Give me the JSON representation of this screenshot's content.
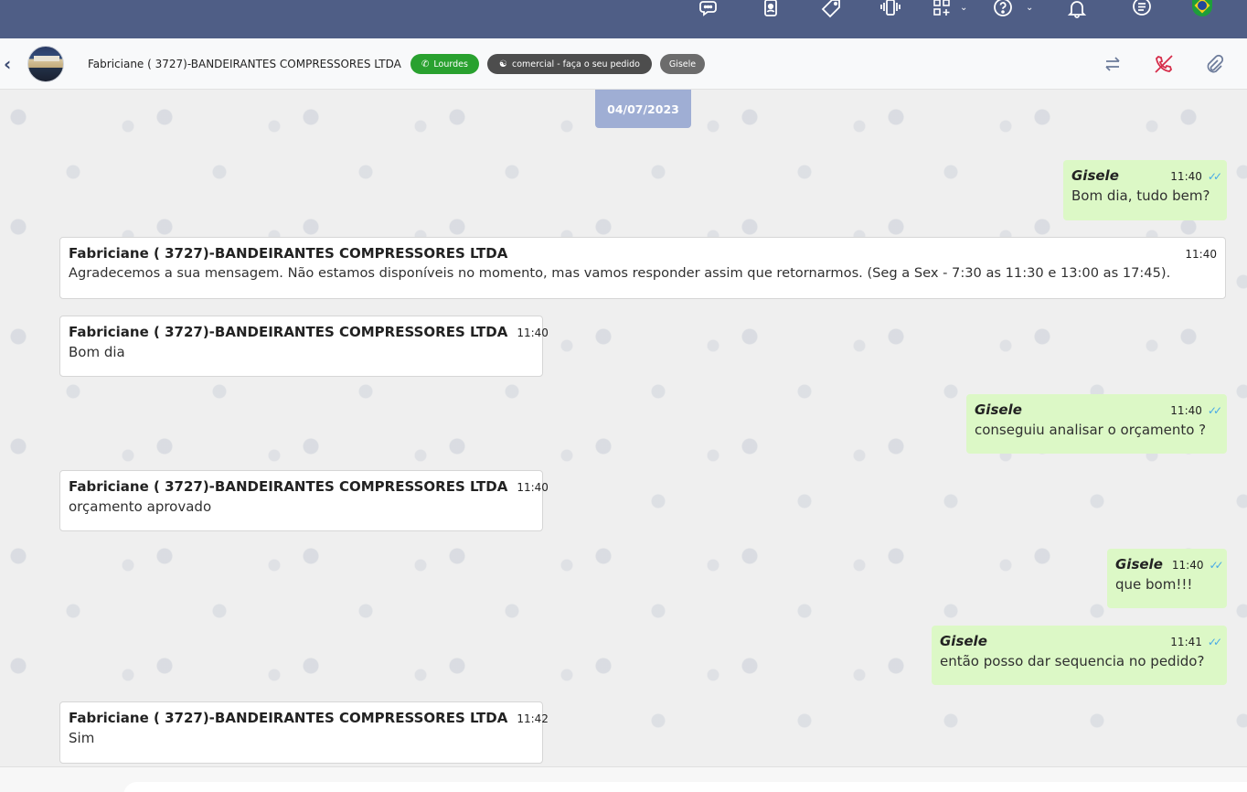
{
  "topbar": {
    "icons": [
      "chat-bubbles-icon",
      "contact-card-icon",
      "tag-icon",
      "phone-vibrate-icon",
      "apps-add-icon",
      "help-icon",
      "bell-icon",
      "list-icon",
      "brazil-flag-icon"
    ]
  },
  "header": {
    "contact_name": "Fabriciane ( 3727)-BANDEIRANTES COMPRESSORES LTDA",
    "tags": {
      "connection": "Lourdes",
      "queue": "comercial - faça o seu pedido",
      "user": "Gisele"
    },
    "colors": {
      "connection": "#29a12f",
      "queue": "#4d4d4d",
      "user": "#6c6c6c"
    }
  },
  "chat": {
    "date": "04/07/2023",
    "messages": [
      {
        "direction": "out",
        "sender": "Gisele",
        "time": "11:40",
        "text": "Bom dia, tudo bem?"
      },
      {
        "direction": "in",
        "sender": "Fabriciane ( 3727)-BANDEIRANTES COMPRESSORES LTDA",
        "time": "11:40",
        "text": "Agradecemos a sua mensagem. Não estamos disponíveis no momento, mas vamos responder assim que retornarmos. (Seg a Sex - 7:30 as 11:30 e 13:00 as 17:45)."
      },
      {
        "direction": "in",
        "sender": "Fabriciane ( 3727)-BANDEIRANTES COMPRESSORES LTDA",
        "time": "11:40",
        "text": "Bom dia"
      },
      {
        "direction": "out",
        "sender": "Gisele",
        "time": "11:40",
        "text": "conseguiu analisar o orçamento ?"
      },
      {
        "direction": "in",
        "sender": "Fabriciane ( 3727)-BANDEIRANTES COMPRESSORES LTDA",
        "time": "11:40",
        "text": "orçamento aprovado"
      },
      {
        "direction": "out",
        "sender": "Gisele",
        "time": "11:40",
        "text": "que bom!!!"
      },
      {
        "direction": "out",
        "sender": "Gisele",
        "time": "11:41",
        "text": "então posso dar sequencia no pedido?"
      },
      {
        "direction": "in",
        "sender": "Fabriciane ( 3727)-BANDEIRANTES COMPRESSORES LTDA",
        "time": "11:42",
        "text": "Sim"
      }
    ]
  }
}
